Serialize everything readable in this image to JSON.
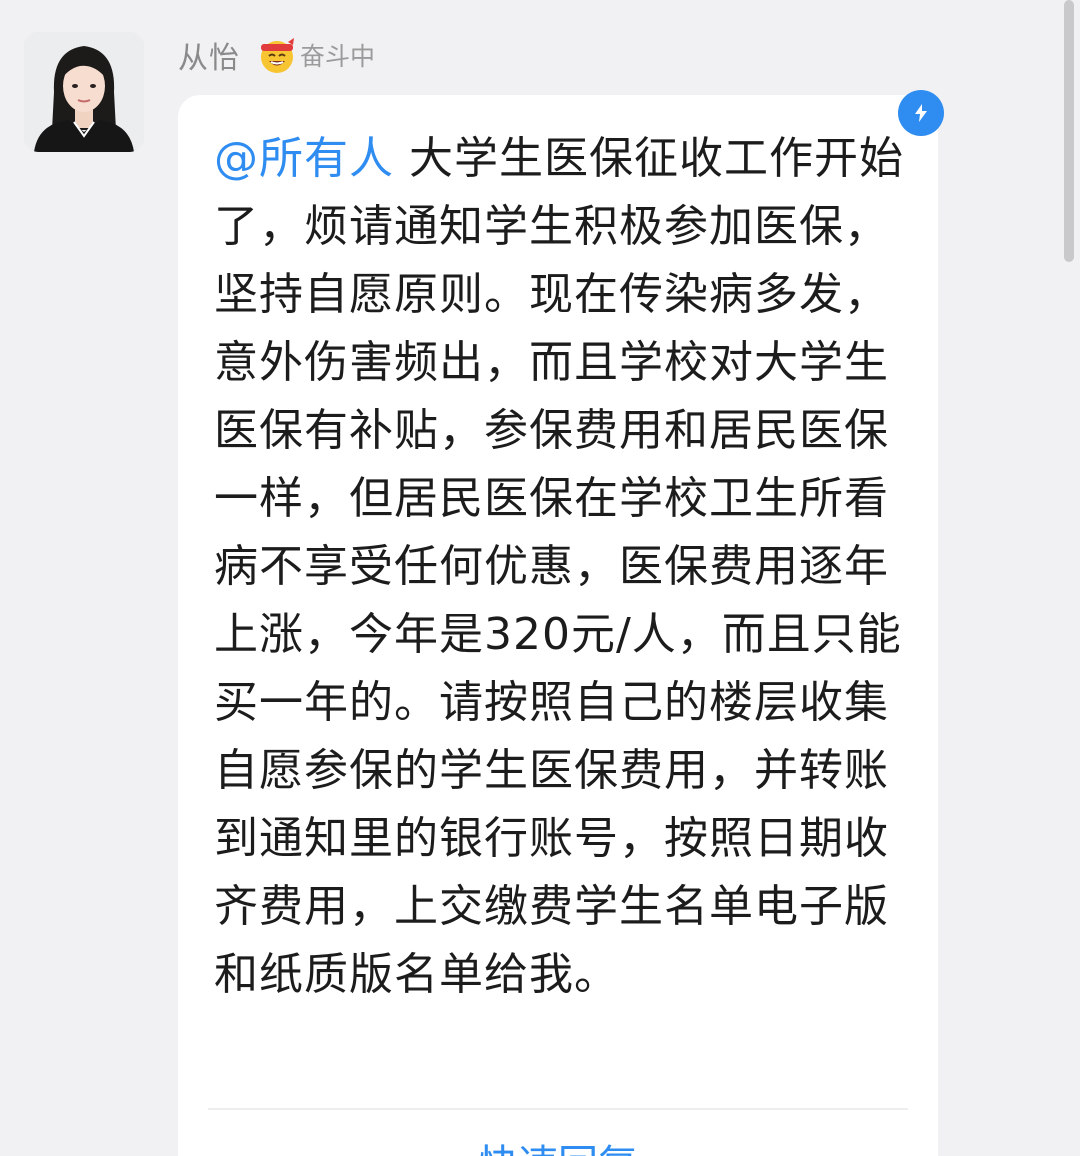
{
  "sender": {
    "name": "从怡",
    "status_emoji": "smiling-face-with-headband-icon",
    "status_text": "奋斗中"
  },
  "message": {
    "mention": "@所有人",
    "body": " 大学生医保征收工作开始了，烦请通知学生积极参加医保，坚持自愿原则。现在传染病多发，意外伤害频出，而且学校对大学生医保有补贴，参保费用和居民医保一样，但居民医保在学校卫生所看病不享受任何优惠，医保费用逐年上涨，今年是320元/人，而且只能买一年的。请按照自己的楼层收集自愿参保的学生医保费用，并转账到通知里的银行账号，按照日期收齐费用，上交缴费学生名单电子版和纸质版名单给我。"
  },
  "badge_icon": "lightning-bolt-icon",
  "quick_reply_label": "快速回复",
  "colors": {
    "accent": "#2f8cf0",
    "background": "#f1f1f3",
    "bubble": "#ffffff"
  }
}
